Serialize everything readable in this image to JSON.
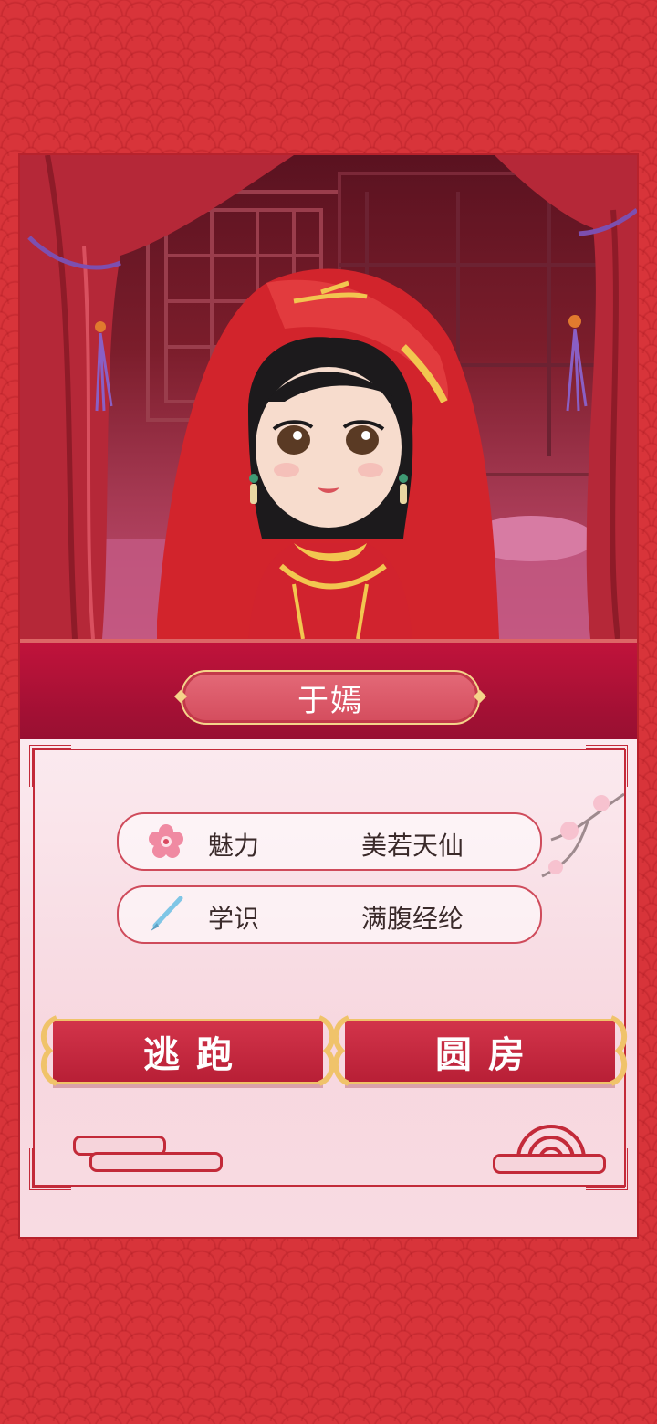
{
  "character": {
    "name": "于嫣"
  },
  "stats": [
    {
      "icon": "plum-blossom-icon",
      "label": "魅力",
      "value": "美若天仙"
    },
    {
      "icon": "writing-brush-icon",
      "label": "学识",
      "value": "满腹经纶"
    }
  ],
  "actions": {
    "escape_label": "逃跑",
    "consummate_label": "圆房"
  },
  "colors": {
    "background": "#d8343a",
    "band": "#c0133b",
    "button": "#c8283f",
    "gold": "#f0c36a"
  }
}
